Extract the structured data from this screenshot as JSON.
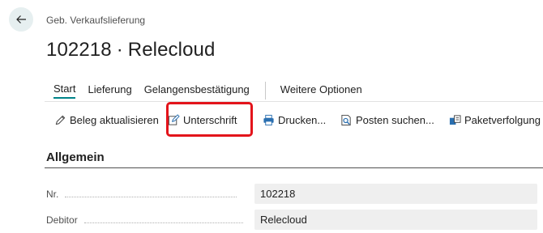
{
  "header": {
    "breadcrumb": "Geb. Verkaufslieferung",
    "document_number": "102218",
    "separator": "·",
    "customer_name": "Relecloud"
  },
  "tabs": [
    {
      "label": "Start",
      "active": true
    },
    {
      "label": "Lieferung",
      "active": false
    },
    {
      "label": "Gelangensbestätigung",
      "active": false
    },
    {
      "label": "Weitere Optionen",
      "active": false
    }
  ],
  "actions": [
    {
      "label": "Beleg aktualisieren",
      "icon": "pencil-icon"
    },
    {
      "label": "Unterschrift",
      "icon": "edit-signature-icon",
      "highlighted": true
    },
    {
      "label": "Drucken...",
      "icon": "printer-icon"
    },
    {
      "label": "Posten suchen...",
      "icon": "search-document-icon"
    },
    {
      "label": "Paketverfolgung",
      "icon": "package-tracking-icon"
    }
  ],
  "section": {
    "title": "Allgemein"
  },
  "fields": [
    {
      "label": "Nr.",
      "value": "102218"
    },
    {
      "label": "Debitor",
      "value": "Relecloud"
    }
  ],
  "colors": {
    "accent": "#008489",
    "highlight": "#e3141b",
    "field_bg": "#efefef"
  }
}
